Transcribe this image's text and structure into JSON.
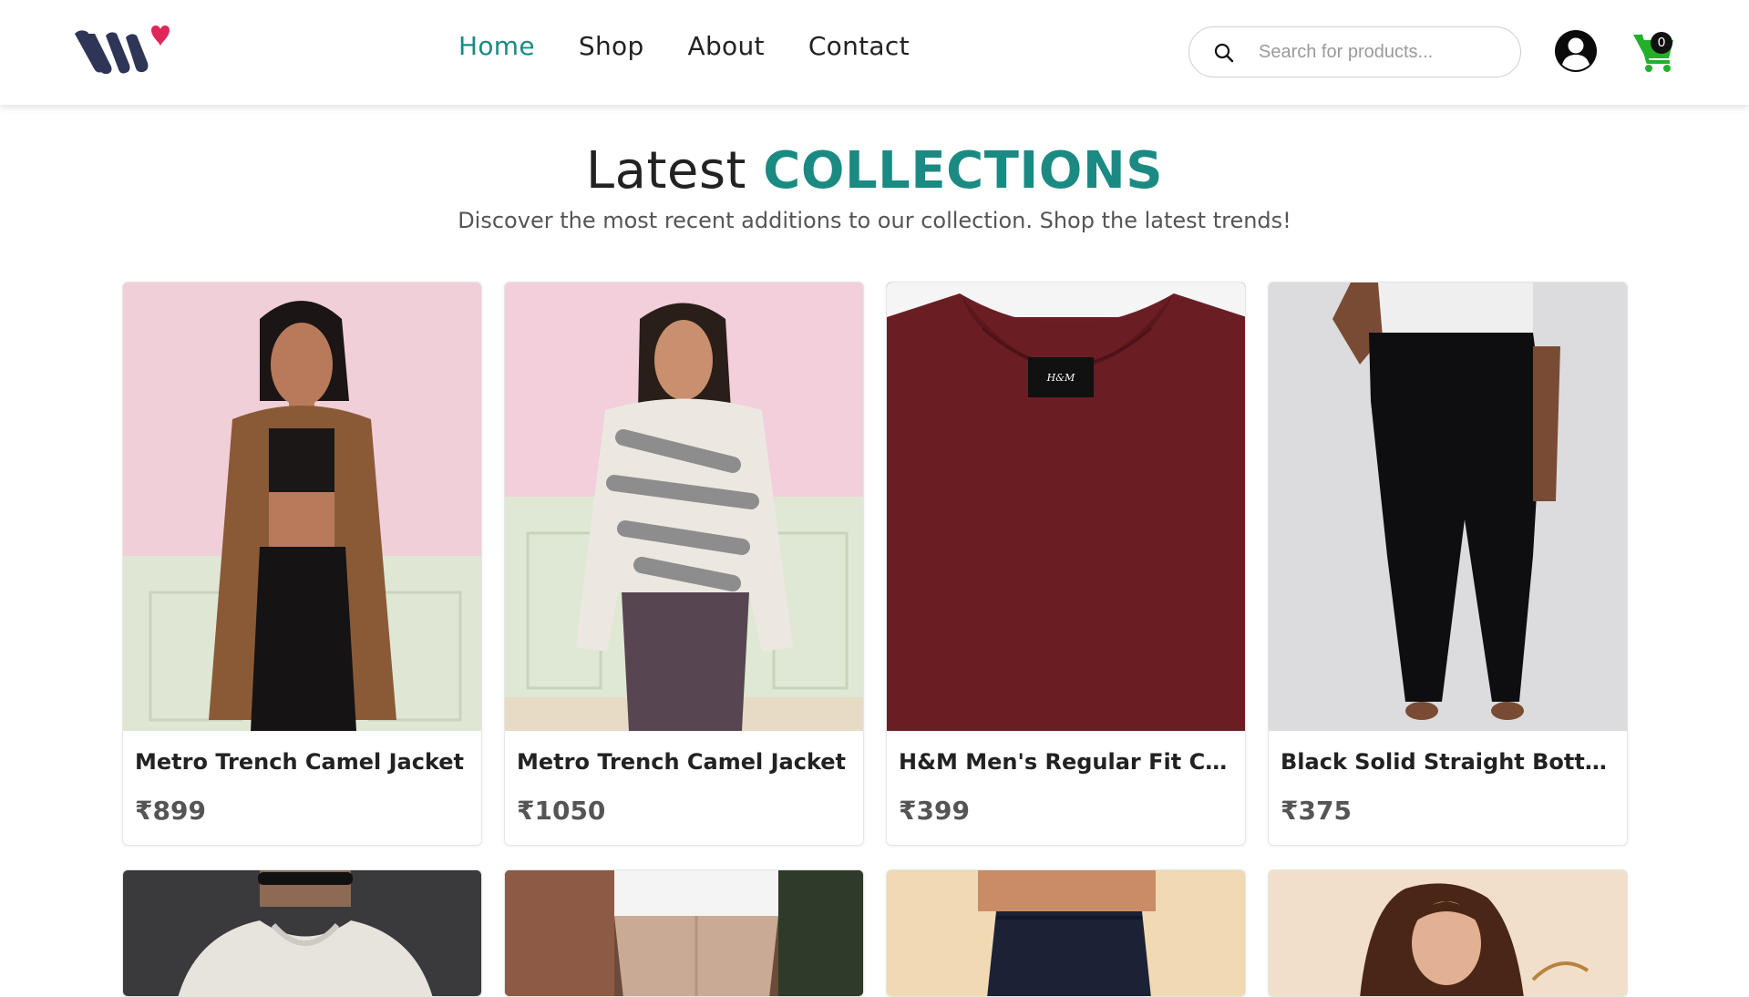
{
  "header": {
    "logo_name": "brand-logo",
    "nav": [
      {
        "label": "Home",
        "active": true
      },
      {
        "label": "Shop",
        "active": false
      },
      {
        "label": "About",
        "active": false
      },
      {
        "label": "Contact",
        "active": false
      }
    ],
    "search": {
      "placeholder": "Search for products...",
      "value": "",
      "icon": "search-icon"
    },
    "account_icon": "user-circle-icon",
    "cart": {
      "icon": "cart-icon",
      "count": "0"
    }
  },
  "section": {
    "title_prefix": "Latest",
    "title_accent": "COLLECTIONS",
    "subtitle": "Discover the most recent additions to our collection. Shop the latest trends!"
  },
  "products": [
    {
      "name": "Metro Trench Camel Jacket",
      "price": "₹899"
    },
    {
      "name": "Metro Trench Camel Jacket",
      "price": "₹1050"
    },
    {
      "name": "H&M Men's Regular Fit Crew-Neck T-shirt",
      "price": "₹399"
    },
    {
      "name": "Black Solid Straight Bottom",
      "price": "₹375"
    }
  ],
  "colors": {
    "accent": "#1a8a83",
    "logo_dark": "#2f3556",
    "logo_heart": "#e0265a",
    "cart_green": "#22b02a"
  }
}
